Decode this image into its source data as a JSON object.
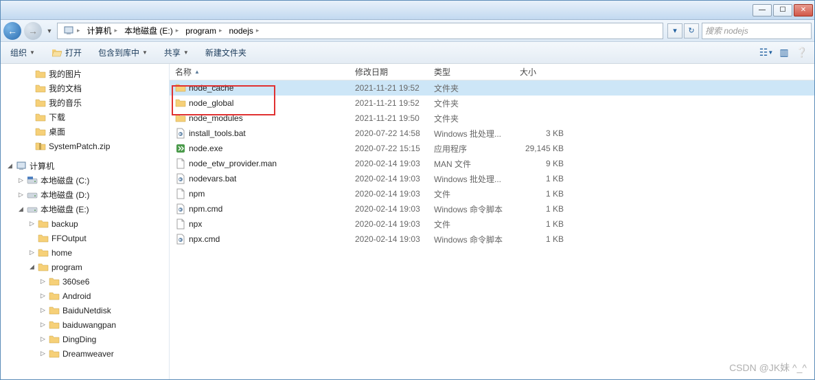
{
  "window": {
    "min": "—",
    "max": "☐",
    "close": "✕"
  },
  "address": {
    "crumbs": [
      "计算机",
      "本地磁盘 (E:)",
      "program",
      "nodejs"
    ]
  },
  "search": {
    "placeholder": "搜索 nodejs"
  },
  "toolbar": {
    "organize": "组织",
    "open": "打开",
    "include": "包含到库中",
    "share": "共享",
    "newfolder": "新建文件夹"
  },
  "sidebar": {
    "items": [
      {
        "label": "我的图片",
        "indent": 38,
        "icon": "folder",
        "exp": ""
      },
      {
        "label": "我的文档",
        "indent": 38,
        "icon": "folder",
        "exp": ""
      },
      {
        "label": "我的音乐",
        "indent": 38,
        "icon": "folder",
        "exp": ""
      },
      {
        "label": "下载",
        "indent": 38,
        "icon": "folder",
        "exp": ""
      },
      {
        "label": "桌面",
        "indent": 38,
        "icon": "folder",
        "exp": ""
      },
      {
        "label": "SystemPatch.zip",
        "indent": 38,
        "icon": "zip",
        "exp": ""
      },
      {
        "label": "计算机",
        "indent": 10,
        "icon": "computer",
        "exp": "◢",
        "section": true
      },
      {
        "label": "本地磁盘 (C:)",
        "indent": 26,
        "icon": "drive-c",
        "exp": "▷"
      },
      {
        "label": "本地磁盘 (D:)",
        "indent": 26,
        "icon": "drive",
        "exp": "▷"
      },
      {
        "label": "本地磁盘 (E:)",
        "indent": 26,
        "icon": "drive",
        "exp": "◢"
      },
      {
        "label": "backup",
        "indent": 42,
        "icon": "folder",
        "exp": "▷"
      },
      {
        "label": "FFOutput",
        "indent": 42,
        "icon": "folder",
        "exp": ""
      },
      {
        "label": "home",
        "indent": 42,
        "icon": "folder",
        "exp": "▷"
      },
      {
        "label": "program",
        "indent": 42,
        "icon": "folder",
        "exp": "◢"
      },
      {
        "label": "360se6",
        "indent": 58,
        "icon": "folder",
        "exp": "▷"
      },
      {
        "label": "Android",
        "indent": 58,
        "icon": "folder",
        "exp": "▷"
      },
      {
        "label": "BaiduNetdisk",
        "indent": 58,
        "icon": "folder",
        "exp": "▷"
      },
      {
        "label": "baiduwangpan",
        "indent": 58,
        "icon": "folder",
        "exp": "▷"
      },
      {
        "label": "DingDing",
        "indent": 58,
        "icon": "folder",
        "exp": "▷"
      },
      {
        "label": "Dreamweaver",
        "indent": 58,
        "icon": "folder",
        "exp": "▷"
      }
    ]
  },
  "columns": {
    "name": "名称",
    "date": "修改日期",
    "type": "类型",
    "size": "大小"
  },
  "files": [
    {
      "name": "node_cache",
      "date": "2021-11-21 19:52",
      "type": "文件夹",
      "size": "",
      "icon": "folder",
      "selected": true
    },
    {
      "name": "node_global",
      "date": "2021-11-21 19:52",
      "type": "文件夹",
      "size": "",
      "icon": "folder"
    },
    {
      "name": "node_modules",
      "date": "2021-11-21 19:50",
      "type": "文件夹",
      "size": "",
      "icon": "folder"
    },
    {
      "name": "install_tools.bat",
      "date": "2020-07-22 14:58",
      "type": "Windows 批处理...",
      "size": "3 KB",
      "icon": "bat"
    },
    {
      "name": "node.exe",
      "date": "2020-07-22 15:15",
      "type": "应用程序",
      "size": "29,145 KB",
      "icon": "exe"
    },
    {
      "name": "node_etw_provider.man",
      "date": "2020-02-14 19:03",
      "type": "MAN 文件",
      "size": "9 KB",
      "icon": "file"
    },
    {
      "name": "nodevars.bat",
      "date": "2020-02-14 19:03",
      "type": "Windows 批处理...",
      "size": "1 KB",
      "icon": "bat"
    },
    {
      "name": "npm",
      "date": "2020-02-14 19:03",
      "type": "文件",
      "size": "1 KB",
      "icon": "file"
    },
    {
      "name": "npm.cmd",
      "date": "2020-02-14 19:03",
      "type": "Windows 命令脚本",
      "size": "1 KB",
      "icon": "bat"
    },
    {
      "name": "npx",
      "date": "2020-02-14 19:03",
      "type": "文件",
      "size": "1 KB",
      "icon": "file"
    },
    {
      "name": "npx.cmd",
      "date": "2020-02-14 19:03",
      "type": "Windows 命令脚本",
      "size": "1 KB",
      "icon": "bat"
    }
  ],
  "watermark": "CSDN @JK妹  ^_^"
}
